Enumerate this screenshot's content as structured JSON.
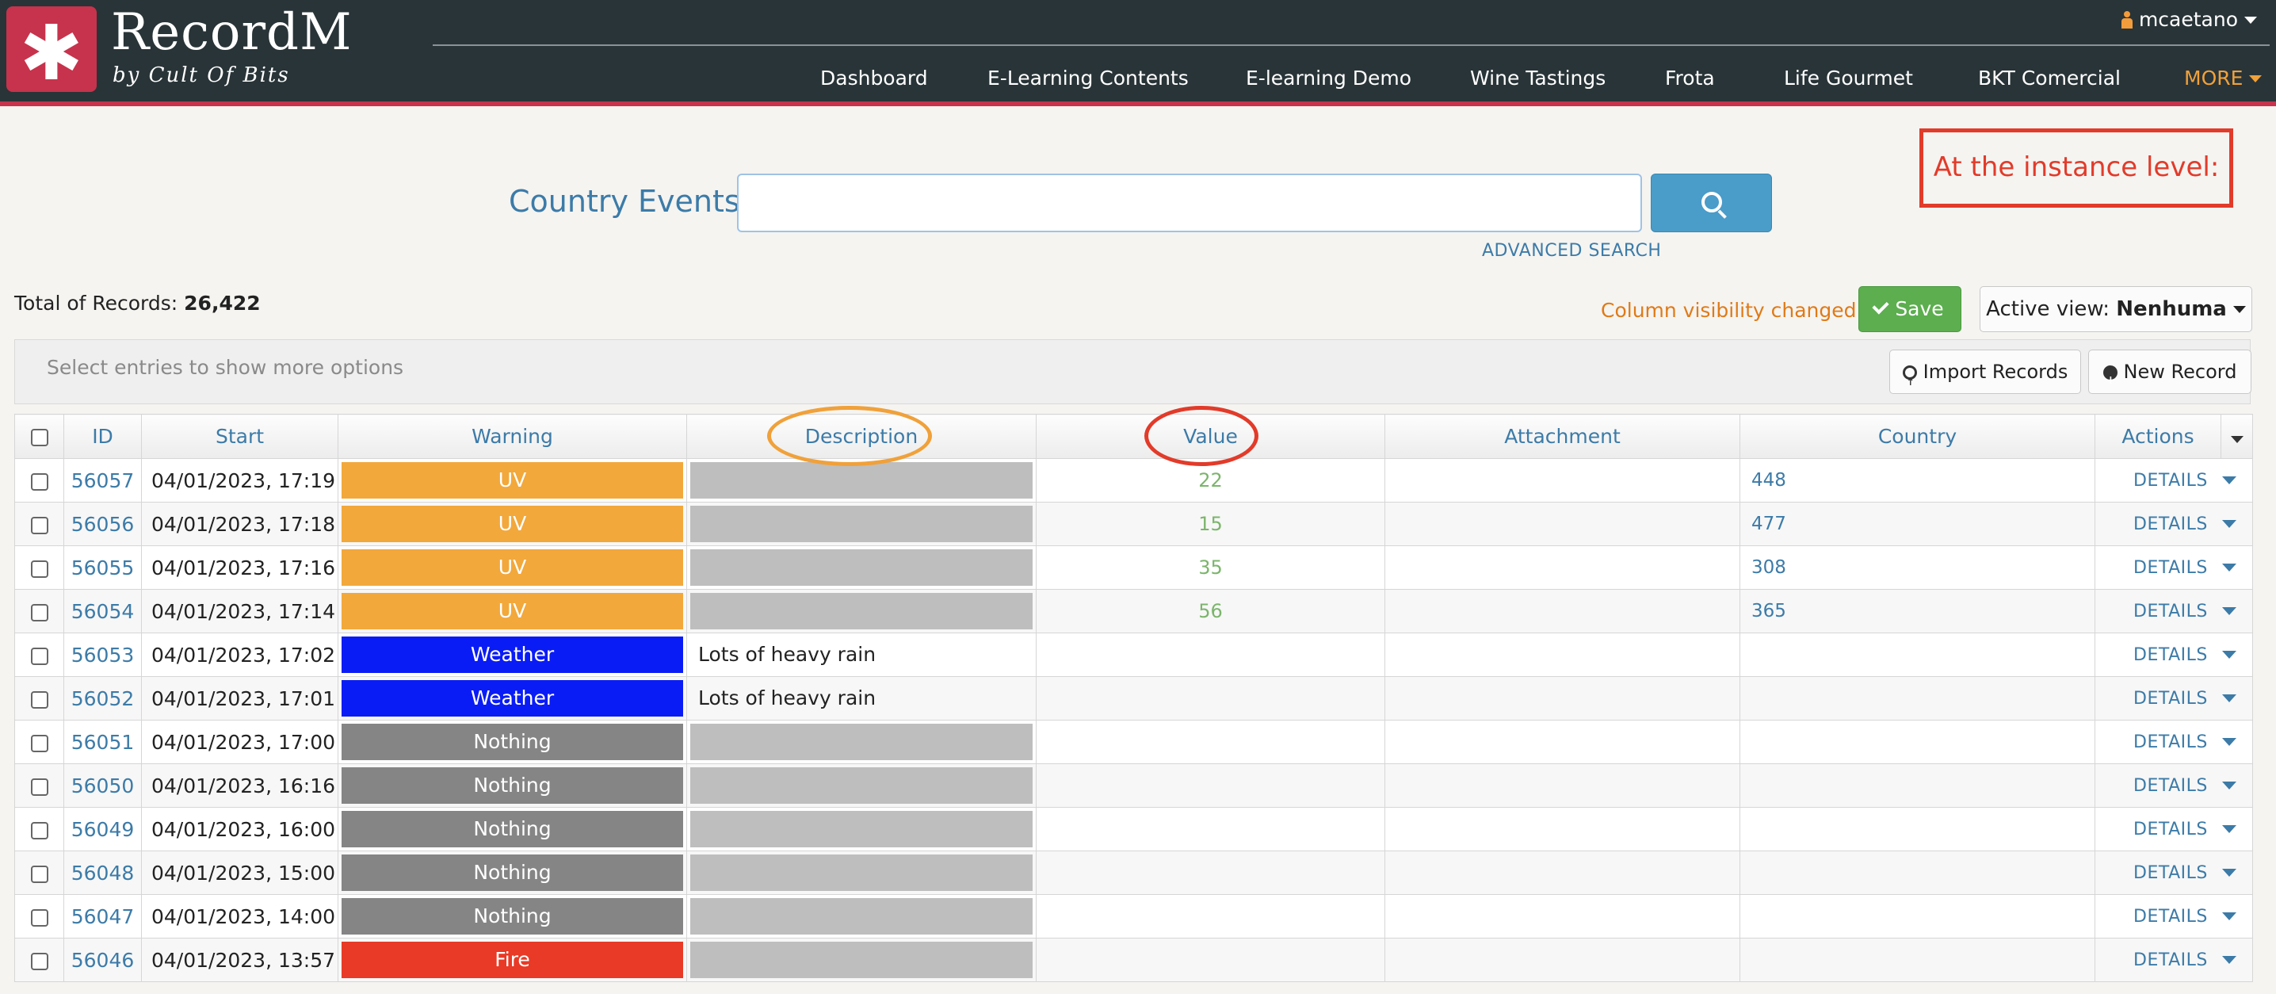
{
  "app": {
    "name": "RecordM",
    "subtitle": "by Cult Of Bits",
    "user": "mcaetano"
  },
  "nav": {
    "items": [
      "Dashboard",
      "E-Learning Contents",
      "E-learning Demo",
      "Wine Tastings",
      "Frota",
      "Life Gourmet",
      "BKT Comercial"
    ],
    "more": "MORE"
  },
  "search": {
    "label": "Country Events",
    "value": "",
    "advanced": "ADVANCED SEARCH"
  },
  "annotation": {
    "text": "At the instance level:"
  },
  "summary": {
    "total_label": "Total of Records:",
    "total_value": "26,422",
    "column_visibility": "Column visibility changed",
    "save": "Save",
    "active_view_label": "Active view:",
    "active_view_value": "Nenhuma"
  },
  "toolbar": {
    "hint": "Select entries to show more options",
    "import": "Import Records",
    "new": "New Record"
  },
  "table": {
    "columns": {
      "id": "ID",
      "start": "Start",
      "warning": "Warning",
      "description": "Description",
      "value": "Value",
      "attachment": "Attachment",
      "country": "Country",
      "actions": "Actions"
    },
    "details_label": "DETAILS",
    "rows": [
      {
        "id": "56057",
        "start": "04/01/2023, 17:19",
        "warning": "UV",
        "description": "",
        "value": "22",
        "country": "448"
      },
      {
        "id": "56056",
        "start": "04/01/2023, 17:18",
        "warning": "UV",
        "description": "",
        "value": "15",
        "country": "477"
      },
      {
        "id": "56055",
        "start": "04/01/2023, 17:16",
        "warning": "UV",
        "description": "",
        "value": "35",
        "country": "308"
      },
      {
        "id": "56054",
        "start": "04/01/2023, 17:14",
        "warning": "UV",
        "description": "",
        "value": "56",
        "country": "365"
      },
      {
        "id": "56053",
        "start": "04/01/2023, 17:02",
        "warning": "Weather",
        "description": "Lots of heavy rain",
        "value": "",
        "country": ""
      },
      {
        "id": "56052",
        "start": "04/01/2023, 17:01",
        "warning": "Weather",
        "description": "Lots of heavy rain",
        "value": "",
        "country": ""
      },
      {
        "id": "56051",
        "start": "04/01/2023, 17:00",
        "warning": "Nothing",
        "description": "",
        "value": "",
        "country": ""
      },
      {
        "id": "56050",
        "start": "04/01/2023, 16:16",
        "warning": "Nothing",
        "description": "",
        "value": "",
        "country": ""
      },
      {
        "id": "56049",
        "start": "04/01/2023, 16:00",
        "warning": "Nothing",
        "description": "",
        "value": "",
        "country": ""
      },
      {
        "id": "56048",
        "start": "04/01/2023, 15:00",
        "warning": "Nothing",
        "description": "",
        "value": "",
        "country": ""
      },
      {
        "id": "56047",
        "start": "04/01/2023, 14:00",
        "warning": "Nothing",
        "description": "",
        "value": "",
        "country": ""
      },
      {
        "id": "56046",
        "start": "04/01/2023, 13:57",
        "warning": "Fire",
        "description": "",
        "value": "",
        "country": ""
      }
    ]
  },
  "colors": {
    "UV": "#f2a83b",
    "Weather": "#0a1cf5",
    "Nothing": "#858585",
    "Fire": "#e83a26",
    "header_bg": "#293438",
    "accent": "#c7334c"
  },
  "icons": {
    "logo": "asterisk-icon",
    "user": "user-icon",
    "search": "search-icon",
    "save": "check-icon",
    "import": "upload-circle-icon",
    "new": "plus-circle-icon"
  }
}
